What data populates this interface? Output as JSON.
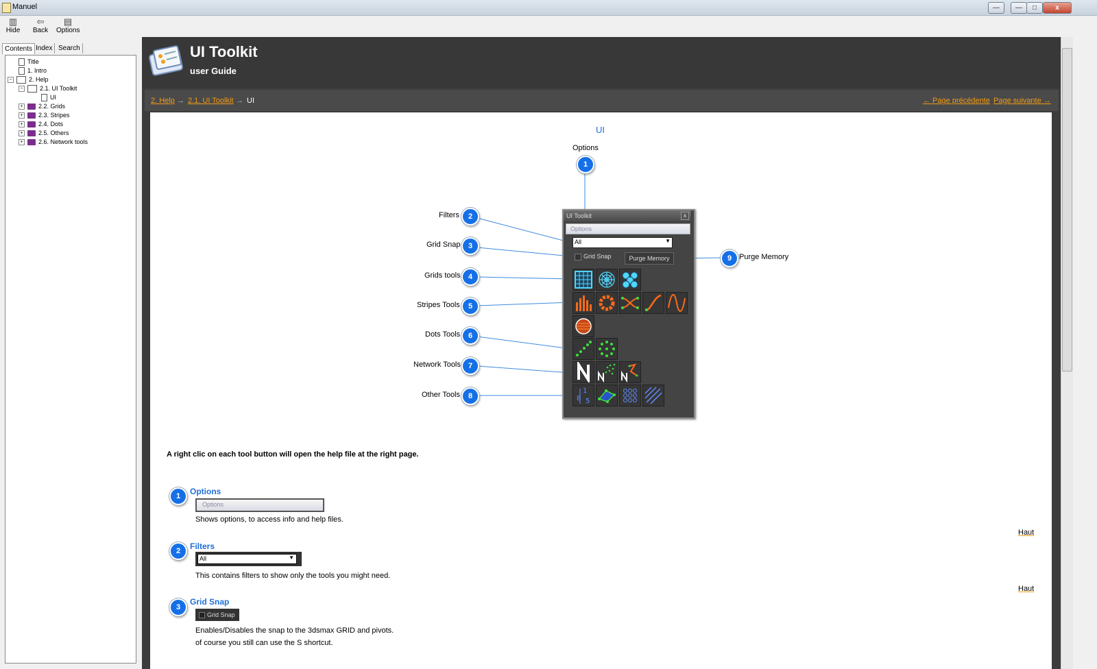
{
  "window": {
    "title": "Manuel",
    "btn_min": "—",
    "btn_max": "□",
    "btn_close": "x"
  },
  "toolbar": {
    "hide": "Hide",
    "back": "Back",
    "options": "Options"
  },
  "left_tabs": {
    "contents": "Contents",
    "index": "Index",
    "search": "Search"
  },
  "tree": [
    {
      "label": "Title",
      "icon": "doc"
    },
    {
      "label": "1. Intro",
      "icon": "doc"
    },
    {
      "label": "2. Help",
      "icon": "open-book",
      "expander": "−"
    },
    {
      "label": "2.1. UI Toolkit",
      "icon": "open-book",
      "expander": "−"
    },
    {
      "label": "UI",
      "icon": "doc"
    },
    {
      "label": "2.2. Grids",
      "icon": "book",
      "expander": "+"
    },
    {
      "label": "2.3. Stripes",
      "icon": "book",
      "expander": "+"
    },
    {
      "label": "2.4. Dots",
      "icon": "book",
      "expander": "+"
    },
    {
      "label": "2.5. Others",
      "icon": "book",
      "expander": "+"
    },
    {
      "label": "2.6. Network tools",
      "icon": "book",
      "expander": "+"
    }
  ],
  "header": {
    "title": "UI Toolkit",
    "subtitle": "user Guide"
  },
  "breadcrumb": {
    "item1": "2. Help",
    "item2": "2.1. UI Toolkit",
    "sep": "→",
    "current": "UI"
  },
  "nav": {
    "prev": "← Page précédente",
    "next": "Page suivante →"
  },
  "page_title": "UI",
  "diagram": {
    "options_label": "Options",
    "labels": [
      "Filters",
      "Grid Snap",
      "Grids tools",
      "Stripes Tools",
      "Dots Tools",
      "Network Tools",
      "Other Tools"
    ],
    "purge_label": "Purge Memory",
    "badges": [
      "1",
      "2",
      "3",
      "4",
      "5",
      "6",
      "7",
      "8",
      "9"
    ],
    "toolwin": {
      "title": "UI Toolkit",
      "close": "x",
      "options": "Options",
      "filter_value": "All",
      "grid_snap": "Grid Snap",
      "purge": "Purge Memory"
    }
  },
  "intro": "A right clic on each tool button will open the help file at the right page.",
  "sections": [
    {
      "num": "1",
      "title": "Options",
      "widget": "Options",
      "desc": "Shows options, to access info and help files."
    },
    {
      "num": "2",
      "title": "Filters",
      "widget": "All",
      "desc": "This contains filters to show only the tools you might need."
    },
    {
      "num": "3",
      "title": "Grid Snap",
      "widget": "Grid Snap",
      "desc": "Enables/Disables the snap to the 3dsmax GRID and pivots.",
      "desc2": "of course you still can use the S shortcut."
    }
  ],
  "haut": "Haut",
  "colors": {
    "accent_orange": "#f39c12",
    "badge_blue": "#1570e8",
    "heading_blue": "#1f6fd8",
    "header_bg": "#383838"
  }
}
